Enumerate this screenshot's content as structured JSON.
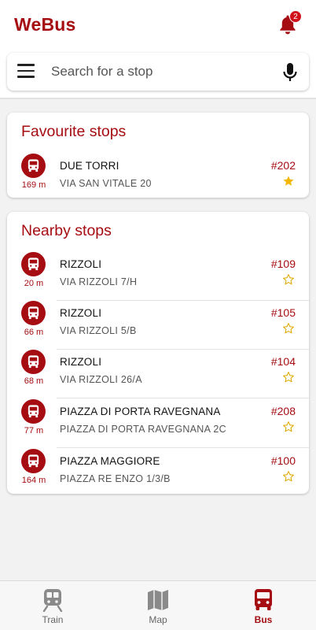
{
  "app": {
    "title": "WeBus",
    "notification_count": "2"
  },
  "search": {
    "placeholder": "Search for a stop"
  },
  "favourites": {
    "title": "Favourite stops",
    "items": [
      {
        "name": "DUE TORRI",
        "address": "VIA SAN VITALE 20",
        "number": "#202",
        "distance": "169 m",
        "favourite": true
      }
    ]
  },
  "nearby": {
    "title": "Nearby stops",
    "items": [
      {
        "name": "RIZZOLI",
        "address": "VIA RIZZOLI 7/H",
        "number": "#109",
        "distance": "20 m",
        "favourite": false
      },
      {
        "name": "RIZZOLI",
        "address": "VIA RIZZOLI 5/B",
        "number": "#105",
        "distance": "66 m",
        "favourite": false
      },
      {
        "name": "RIZZOLI",
        "address": "VIA RIZZOLI 26/A",
        "number": "#104",
        "distance": "68 m",
        "favourite": false
      },
      {
        "name": "PIAZZA DI PORTA RAVEGNANA",
        "address": "PIAZZA DI PORTA RAVEGNANA 2C",
        "number": "#208",
        "distance": "77 m",
        "favourite": false
      },
      {
        "name": "PIAZZA MAGGIORE",
        "address": "PIAZZA RE ENZO 1/3/B",
        "number": "#100",
        "distance": "164 m",
        "favourite": false
      }
    ]
  },
  "nav": {
    "train": "Train",
    "map": "Map",
    "bus": "Bus",
    "active": "bus"
  },
  "colors": {
    "accent": "#a50d12",
    "star_filled": "#f2b705",
    "star_outline": "#e0a800"
  }
}
